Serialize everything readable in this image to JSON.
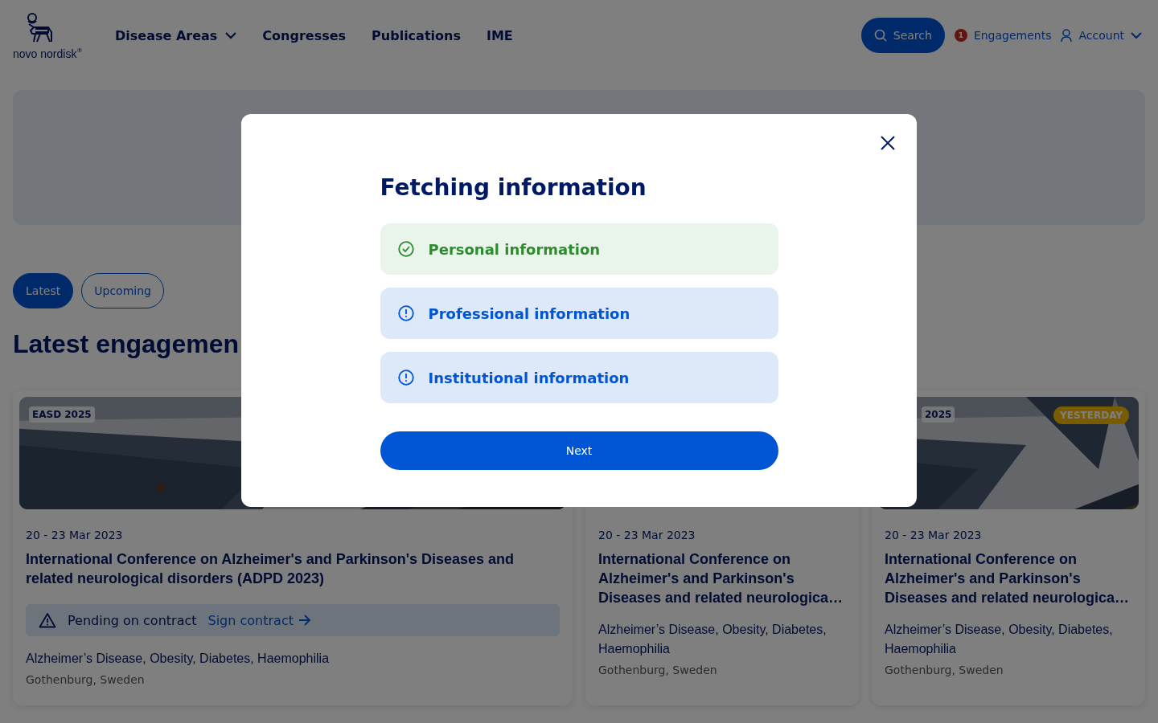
{
  "header": {
    "logo": {
      "text": "novo nordisk",
      "mark": "®"
    },
    "nav": [
      {
        "label": "Disease Areas",
        "dropdown": true
      },
      {
        "label": "Congresses",
        "dropdown": false
      },
      {
        "label": "Publications",
        "dropdown": false
      },
      {
        "label": "IME",
        "dropdown": false
      }
    ],
    "search_button": "Search",
    "engagements": {
      "count": "1",
      "label": "Engagements"
    },
    "account": "Account"
  },
  "filter_tabs": [
    {
      "label": "Latest",
      "selected": true
    },
    {
      "label": "Upcoming",
      "selected": false
    }
  ],
  "section_title": "Latest engagemen",
  "cards": [
    {
      "badge": "EASD 2025",
      "date": "20 - 23 Mar 2023",
      "title": "International Conference on Alzheimer's and Parkinson's Diseases and related neurological disorders (ADPD 2023)",
      "contract": {
        "status": "Pending on contract",
        "link": "Sign contract"
      },
      "areas": "Alzheimer’s Disease, Obesity, Diabetes, Haemophilia",
      "location": "Gothenburg, Sweden"
    },
    {
      "date": "20 - 23 Mar 2023",
      "title": "International Conference on Alzheimer's and Parkinson's Diseases and related neurologica…",
      "areas": "Alzheimer’s Disease, Obesity, Diabetes, Haemophilia",
      "location": "Gothenburg, Sweden"
    },
    {
      "badge": "2025",
      "tag": "YESTERDAY",
      "date": "20 - 23 Mar 2023",
      "title": "International Conference on Alzheimer's and Parkinson's Diseases and related neurologica…",
      "areas": "Alzheimer’s Disease, Obesity, Diabetes, Haemophilia",
      "location": "Gothenburg, Sweden"
    }
  ],
  "modal": {
    "title": "Fetching information",
    "steps": [
      {
        "label": "Personal information",
        "complete": true
      },
      {
        "label": "Professional information",
        "complete": false
      },
      {
        "label": "Institutional information",
        "complete": false
      }
    ],
    "button": "Next"
  }
}
